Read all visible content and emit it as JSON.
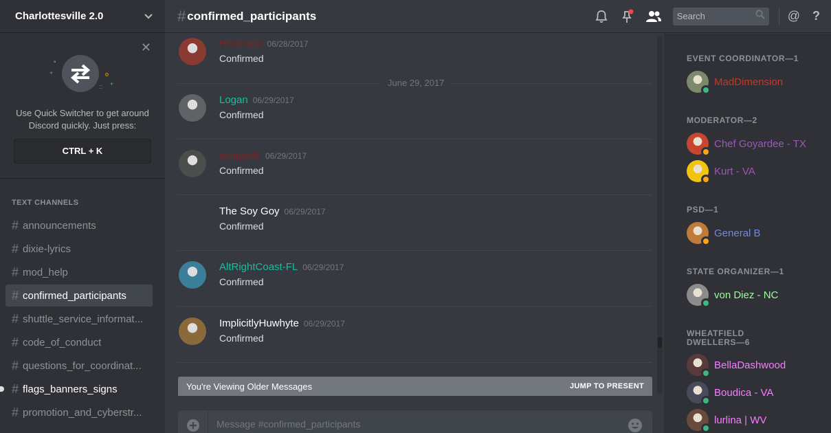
{
  "server": {
    "name": "Charlottesville 2.0",
    "chevron_icon": "chevron-down-icon"
  },
  "quick_switcher": {
    "text_line1": "Use Quick Switcher to get around",
    "text_line2": "Discord quickly. Just press:",
    "shortcut": "CTRL + K"
  },
  "channels": {
    "category": "TEXT CHANNELS",
    "items": [
      {
        "label": "announcements",
        "state": "normal"
      },
      {
        "label": "dixie-lyrics",
        "state": "normal"
      },
      {
        "label": "mod_help",
        "state": "normal"
      },
      {
        "label": "confirmed_participants",
        "state": "selected"
      },
      {
        "label": "shuttle_service_informat...",
        "state": "normal"
      },
      {
        "label": "code_of_conduct",
        "state": "normal"
      },
      {
        "label": "questions_for_coordinat...",
        "state": "normal"
      },
      {
        "label": "flags_banners_signs",
        "state": "unread"
      },
      {
        "label": "promotion_and_cyberstr...",
        "state": "normal"
      }
    ]
  },
  "header": {
    "hash": "#",
    "channel": "confirmed_participants",
    "search_placeholder": "Search",
    "mention_glyph": "@",
    "help_glyph": "?"
  },
  "messages": {
    "date_divider": "June 29, 2017",
    "items": [
      {
        "author": "Hardrada",
        "time": "06/28/2017",
        "text": "Confirmed",
        "color": "#7a2323",
        "avatar": "#8a3a30"
      },
      {
        "author": "Logan",
        "time": "06/29/2017",
        "text": "Confirmed",
        "color": "#1abc9c",
        "avatar": "#5f6366"
      },
      {
        "author": "tscags88",
        "time": "06/29/2017",
        "text": "Confirmed",
        "color": "#7a2323",
        "avatar": "#4a4f4b"
      },
      {
        "author": "The Soy Goy",
        "time": "06/29/2017",
        "text": "Confirmed",
        "color": "#ffffff",
        "avatar": ""
      },
      {
        "author": "AltRightCoast-FL",
        "time": "06/29/2017",
        "text": "Confirmed",
        "color": "#1abc9c",
        "avatar": "#3b7f9a"
      },
      {
        "author": "ImplicitlyHuwhyte",
        "time": "06/29/2017",
        "text": "Confirmed",
        "color": "#ffffff",
        "avatar": "#8a6a3a"
      }
    ],
    "older_banner": "You're Viewing Older Messages",
    "jump_label": "JUMP TO PRESENT"
  },
  "composer": {
    "placeholder": "Message #confirmed_participants"
  },
  "members": {
    "groups": [
      {
        "role": "EVENT COORDINATOR—1",
        "members": [
          {
            "name": "MadDimension",
            "color": "#c0392b",
            "status": "online",
            "avatar": "#7a8a6a"
          }
        ]
      },
      {
        "role": "MODERATOR—2",
        "members": [
          {
            "name": "Chef Goyardee - TX",
            "color": "#9b59b6",
            "status": "idle",
            "avatar": "#c8452f"
          },
          {
            "name": "Kurt - VA",
            "color": "#9b59b6",
            "status": "idle",
            "avatar": "#f1c40f"
          }
        ]
      },
      {
        "role": "PSD—1",
        "members": [
          {
            "name": "General B",
            "color": "#7289da",
            "status": "idle",
            "avatar": "#c07a3a"
          }
        ]
      },
      {
        "role": "STATE ORGANIZER—1",
        "members": [
          {
            "name": "von Diez - NC",
            "color": "#99ff99",
            "status": "online",
            "avatar": "#8c8c8c"
          }
        ]
      },
      {
        "role": "WHEATFIELD DWELLERS—6",
        "members": [
          {
            "name": "BellaDashwood",
            "color": "#f47fff",
            "status": "online",
            "avatar": "#5a3a3a"
          },
          {
            "name": "Boudica - VA",
            "color": "#f47fff",
            "status": "online",
            "avatar": "#4a4a5a"
          },
          {
            "name": "lurlina | WV",
            "color": "#f47fff",
            "status": "online",
            "avatar": "#6a4a3a"
          }
        ]
      }
    ],
    "status_colors": {
      "online": "#43b581",
      "idle": "#faa61a"
    }
  }
}
